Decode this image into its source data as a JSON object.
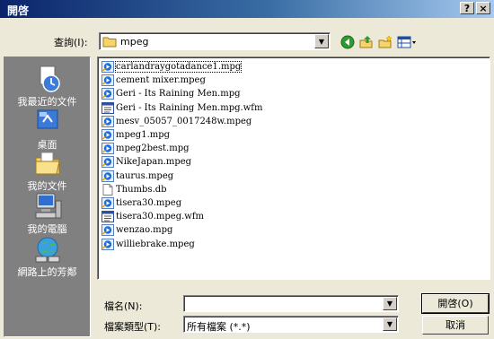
{
  "window": {
    "title": "開啓",
    "help_label": "?",
    "close_label": "×"
  },
  "lookin": {
    "label": "查詢(I):",
    "value": "mpeg"
  },
  "places": [
    {
      "label": "我最近的文件",
      "icon": "recent-documents-icon"
    },
    {
      "label": "桌面",
      "icon": "desktop-icon"
    },
    {
      "label": "我的文件",
      "icon": "my-documents-icon"
    },
    {
      "label": "我的電腦",
      "icon": "my-computer-icon"
    },
    {
      "label": "網路上的芳鄰",
      "icon": "network-places-icon"
    }
  ],
  "files": [
    {
      "name": "carlandraygotadance1.mpg",
      "icon": "media-file-icon"
    },
    {
      "name": "cement mixer.mpeg",
      "icon": "media-file-icon"
    },
    {
      "name": "Geri - Its Raining Men.mpg",
      "icon": "media-file-icon"
    },
    {
      "name": "Geri - Its Raining Men.mpg.wfm",
      "icon": "wfm-file-icon"
    },
    {
      "name": "mesv_05057_0017248w.mpeg",
      "icon": "media-file-icon"
    },
    {
      "name": "mpeg1.mpg",
      "icon": "media-file-icon"
    },
    {
      "name": "mpeg2best.mpg",
      "icon": "media-file-icon"
    },
    {
      "name": "NikeJapan.mpeg",
      "icon": "media-file-icon"
    },
    {
      "name": "taurus.mpeg",
      "icon": "media-file-icon"
    },
    {
      "name": "Thumbs.db",
      "icon": "db-file-icon"
    },
    {
      "name": "tisera30.mpeg",
      "icon": "media-file-icon"
    },
    {
      "name": "tisera30.mpeg.wfm",
      "icon": "wfm-file-icon"
    },
    {
      "name": "wenzao.mpg",
      "icon": "media-file-icon"
    },
    {
      "name": "williebrake.mpeg",
      "icon": "media-file-icon"
    }
  ],
  "filename": {
    "label": "檔名(N):",
    "value": ""
  },
  "filetype": {
    "label": "檔案類型(T):",
    "value": "所有檔案 (*.*)"
  },
  "buttons": {
    "open": "開啓(O)",
    "cancel": "取消"
  },
  "colors": {
    "title_start": "#0a246a",
    "title_end": "#a6caf0",
    "places_bg": "#808080",
    "dialog_bg": "#ece9d8"
  }
}
